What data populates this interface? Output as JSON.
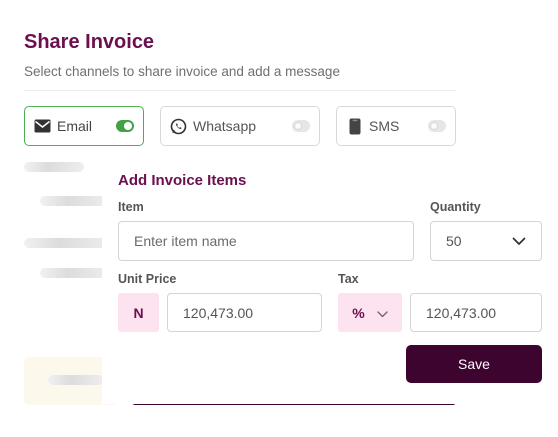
{
  "share": {
    "title": "Share Invoice",
    "subtitle": "Select channels to share invoice and add a message"
  },
  "channels": [
    {
      "label": "Email",
      "icon": "mail-icon",
      "enabled": true
    },
    {
      "label": "Whatsapp",
      "icon": "whatsapp-icon",
      "enabled": false
    },
    {
      "label": "SMS",
      "icon": "phone-icon",
      "enabled": false
    }
  ],
  "add_items": {
    "title": "Add Invoice Items",
    "item_label": "Item",
    "item_placeholder": "Enter item name",
    "quantity_label": "Quantity",
    "quantity_value": "50",
    "unit_price_label": "Unit Price",
    "currency_symbol": "N",
    "unit_price_value": "120,473.00",
    "tax_label": "Tax",
    "tax_type": "%",
    "tax_value": "120,473.00",
    "save_label": "Save"
  },
  "colors": {
    "brand": "#6b0f4f",
    "button": "#3d0430",
    "toggle_on": "#43a047",
    "chip_bg": "#fde2ef"
  }
}
